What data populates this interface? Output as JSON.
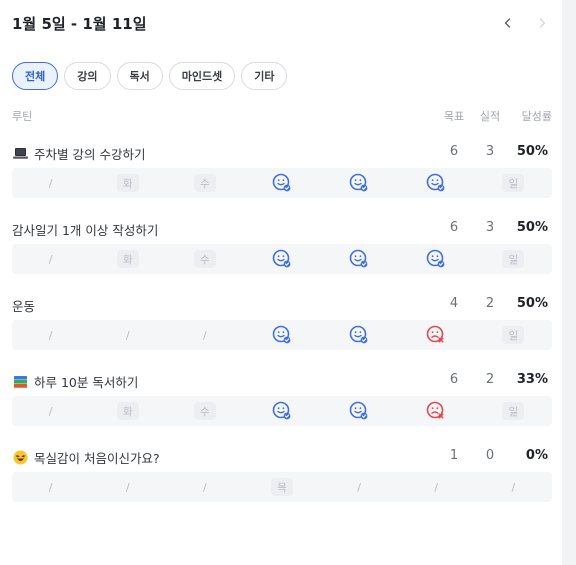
{
  "header": {
    "date_range": "1월 5일 - 1월 11일",
    "prev_icon": "chevron-left-icon",
    "next_icon": "chevron-right-icon"
  },
  "filters": [
    {
      "label": "전체",
      "active": true
    },
    {
      "label": "강의",
      "active": false
    },
    {
      "label": "독서",
      "active": false
    },
    {
      "label": "마인드셋",
      "active": false
    },
    {
      "label": "기타",
      "active": false
    }
  ],
  "columns": {
    "routine": "루틴",
    "goal": "목표",
    "actual": "실적",
    "rate": "달성률"
  },
  "routines": [
    {
      "title": "주차별 강의 수강하기",
      "icon": "laptop-icon",
      "goal": "6",
      "actual": "3",
      "rate": "50%",
      "days": [
        {
          "t": "slash",
          "v": "/"
        },
        {
          "t": "pill",
          "v": "화"
        },
        {
          "t": "pill",
          "v": "수"
        },
        {
          "t": "happy"
        },
        {
          "t": "happy"
        },
        {
          "t": "happy"
        },
        {
          "t": "pill",
          "v": "일"
        }
      ]
    },
    {
      "title": "감사일기 1개 이상 작성하기",
      "icon": "",
      "goal": "6",
      "actual": "3",
      "rate": "50%",
      "days": [
        {
          "t": "slash",
          "v": "/"
        },
        {
          "t": "pill",
          "v": "화"
        },
        {
          "t": "pill",
          "v": "수"
        },
        {
          "t": "happy"
        },
        {
          "t": "happy"
        },
        {
          "t": "happy"
        },
        {
          "t": "pill",
          "v": "일"
        }
      ]
    },
    {
      "title": "운동",
      "icon": "",
      "goal": "4",
      "actual": "2",
      "rate": "50%",
      "days": [
        {
          "t": "slash",
          "v": "/"
        },
        {
          "t": "slash",
          "v": "/"
        },
        {
          "t": "slash",
          "v": "/"
        },
        {
          "t": "happy"
        },
        {
          "t": "happy"
        },
        {
          "t": "sad"
        },
        {
          "t": "pill",
          "v": "일"
        }
      ]
    },
    {
      "title": "하루 10분 독서하기",
      "icon": "books-icon",
      "goal": "6",
      "actual": "2",
      "rate": "33%",
      "days": [
        {
          "t": "slash",
          "v": "/"
        },
        {
          "t": "pill",
          "v": "화"
        },
        {
          "t": "pill",
          "v": "수"
        },
        {
          "t": "happy"
        },
        {
          "t": "happy"
        },
        {
          "t": "sad"
        },
        {
          "t": "pill",
          "v": "일"
        }
      ]
    },
    {
      "title": "목실감이 처음이신가요?",
      "icon": "laughing-face-icon",
      "goal": "1",
      "actual": "0",
      "rate": "0%",
      "days": [
        {
          "t": "slash",
          "v": "/"
        },
        {
          "t": "slash",
          "v": "/"
        },
        {
          "t": "slash",
          "v": "/"
        },
        {
          "t": "pill",
          "v": "목"
        },
        {
          "t": "slash",
          "v": "/"
        },
        {
          "t": "slash",
          "v": "/"
        },
        {
          "t": "slash",
          "v": "/"
        }
      ]
    }
  ],
  "colors": {
    "accent": "#3f6fe0",
    "done": "#3f6fe0",
    "missed": "#e5484d",
    "empty_bg": "#f5f6f8"
  }
}
